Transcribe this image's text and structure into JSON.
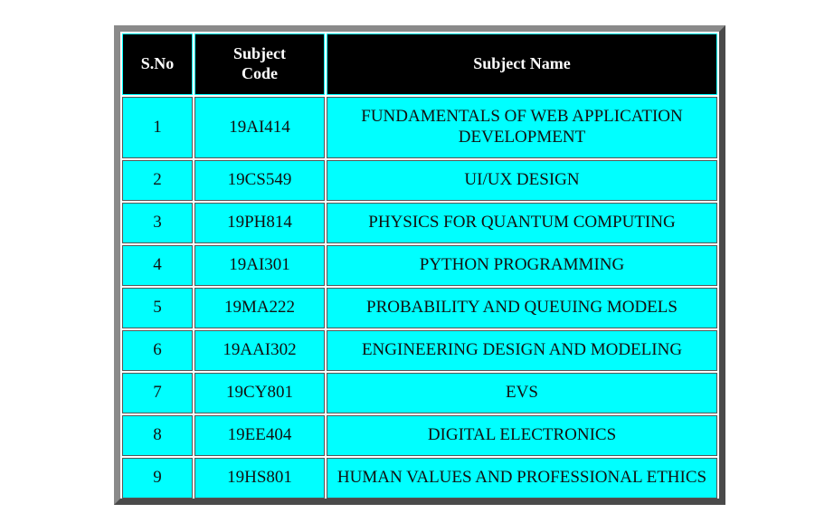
{
  "table": {
    "headers": {
      "sno": "S.No",
      "code": "Subject Code",
      "name": "Subject Name"
    },
    "rows": [
      {
        "sno": "1",
        "code": "19AI414",
        "name": "FUNDAMENTALS OF WEB APPLICATION DEVELOPMENT"
      },
      {
        "sno": "2",
        "code": "19CS549",
        "name": "UI/UX DESIGN"
      },
      {
        "sno": "3",
        "code": "19PH814",
        "name": "PHYSICS FOR QUANTUM COMPUTING"
      },
      {
        "sno": "4",
        "code": "19AI301",
        "name": "PYTHON PROGRAMMING"
      },
      {
        "sno": "5",
        "code": "19MA222",
        "name": "PROBABILITY AND QUEUING MODELS"
      },
      {
        "sno": "6",
        "code": "19AAI302",
        "name": "ENGINEERING DESIGN AND MODELING"
      },
      {
        "sno": "7",
        "code": "19CY801",
        "name": "EVS"
      },
      {
        "sno": "8",
        "code": "19EE404",
        "name": "DIGITAL ELECTRONICS"
      },
      {
        "sno": "9",
        "code": "19HS801",
        "name": "HUMAN VALUES AND PROFESSIONAL ETHICS"
      }
    ]
  },
  "colors": {
    "header_bg": "#000000",
    "header_text": "#ffffff",
    "cell_bg": "#00ffff",
    "frame": "#6b6b6b"
  }
}
